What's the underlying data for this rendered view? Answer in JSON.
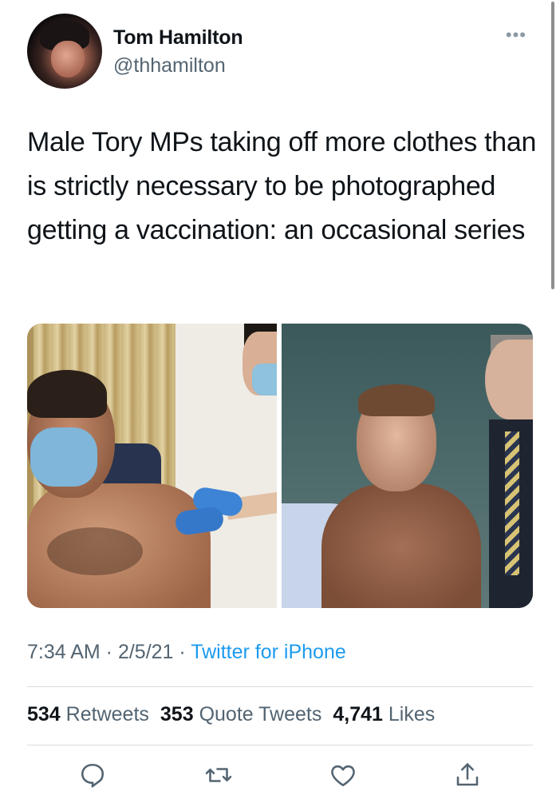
{
  "author": {
    "name": "Tom Hamilton",
    "handle": "@thhamilton"
  },
  "tweet": {
    "text": "Male Tory MPs taking off more clothes than is strictly necessary to be photographed getting a vaccination: an occasional series"
  },
  "meta": {
    "time": "7:34 AM",
    "date": "2/5/21",
    "source": "Twitter for iPhone",
    "separator": " · "
  },
  "stats": {
    "retweets": {
      "count": "534",
      "label": "Retweets"
    },
    "quotes": {
      "count": "353",
      "label": "Quote Tweets"
    },
    "likes": {
      "count": "4,741",
      "label": "Likes"
    }
  },
  "icons": {
    "more": "more-icon",
    "reply": "reply-icon",
    "retweet": "retweet-icon",
    "like": "like-icon",
    "share": "share-icon"
  },
  "colors": {
    "link": "#1d9bf0",
    "muted": "#536471",
    "text": "#0f1419"
  }
}
